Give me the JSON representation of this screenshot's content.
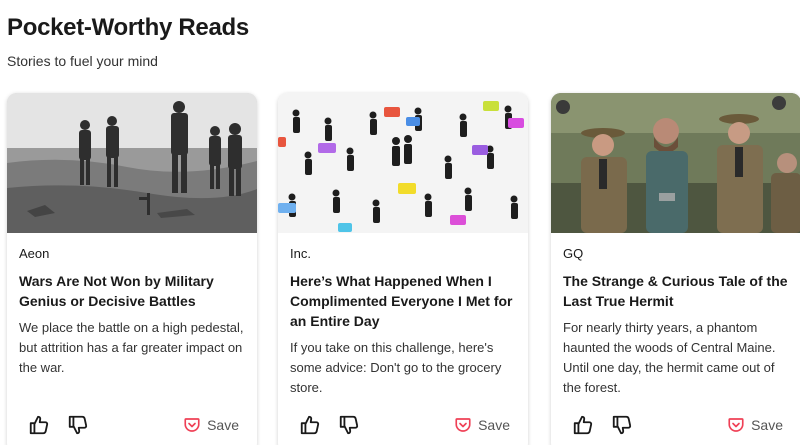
{
  "header": {
    "title": "Pocket-Worthy Reads",
    "subtitle": "Stories to fuel your mind"
  },
  "colors": {
    "save_accent": "#ef4056",
    "text": "#1a1a1a"
  },
  "cards": [
    {
      "publisher": "Aeon",
      "headline": "Wars Are Not Won by Military Genius or Decisive Battles",
      "excerpt": "We place the battle on a high pedestal, but attrition has a far greater impact on the war.",
      "save_label": "Save",
      "image_icon": "soldiers-battlefield-photo"
    },
    {
      "publisher": "Inc.",
      "headline": "Here’s What Happened When I Complimented Everyone I Met for an Entire Day",
      "excerpt": "If you take on this challenge, here's some advice: Don't go to the grocery store.",
      "save_label": "Save",
      "image_icon": "people-speech-bubbles-illustration"
    },
    {
      "publisher": "GQ",
      "headline": "The Strange & Curious Tale of the Last True Hermit",
      "excerpt": "For nearly thirty years, a phantom haunted the woods of Central Maine. Until one day, the hermit came out of the forest.",
      "save_label": "Save",
      "image_icon": "police-escort-photo"
    }
  ]
}
